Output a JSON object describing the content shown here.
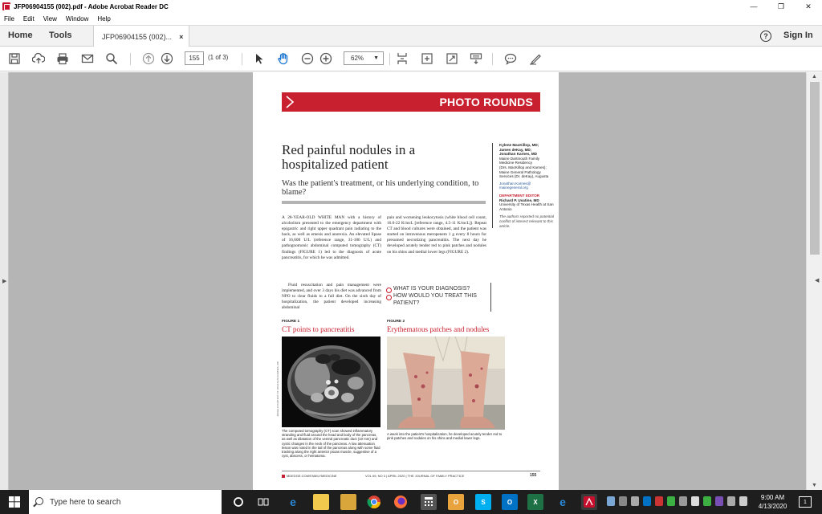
{
  "window": {
    "title": "JFP06904155 (002).pdf - Adobe Acrobat Reader DC",
    "minimize": "—",
    "restore": "❐",
    "close": "✕"
  },
  "menu": [
    "File",
    "Edit",
    "View",
    "Window",
    "Help"
  ],
  "tabs": {
    "home": "Home",
    "tools": "Tools",
    "doc": "JFP06904155 (002)...",
    "close": "×",
    "help": "?",
    "signin": "Sign In"
  },
  "toolbar": {
    "page_current": "155",
    "page_of": "(1 of 3)",
    "zoom": "62%"
  },
  "doc": {
    "banner": "PHOTO ROUNDS",
    "title": "Red painful nodules in a hospitalized patient",
    "subtitle": "Was the patient's treatment, or his underlying condition, to blame?",
    "authors": [
      {
        "text": "Kylene MacKillop, MD;",
        "bold": true
      },
      {
        "text": "James deKay, MD;",
        "bold": true
      },
      {
        "text": "Jonathan Karnes, MD",
        "bold": true
      },
      {
        "text": "Maine Dartmouth Family Medicine Residency",
        "bold": false
      },
      {
        "text": "(Drs. MacKillop and Karnes); Maine General Pathology Services (Dr. deKay), Augusta",
        "bold": false
      }
    ],
    "email": "Jonathan.Karnes@ mainegeneral.org",
    "dept_label": "DEPARTMENT EDITOR",
    "dept_name": "Richard P. Usatine, MD",
    "dept_affil": "University of Texas Health at San Antonio",
    "disclosure": "The authors reported no potential conflict of interest relevant to this article.",
    "col1_p1": "A 28-YEAR-OLD WHITE MAN with a history of alcoholism presented to the emergency department with epigastric and right upper quadrant pain radiating to the back, as well as emesis and anorexia. An elevated lipase of 16,608 U/L (reference range, 31-186 U/L) and pathognomonic abdominal computed tomography (CT) findings (FIGURE 1) led to the diagnosis of acute pancreatitis, for which he was admitted.",
    "col1_p2": "Fluid resuscitation and pain management were implemented, and over 3 days his diet was advanced from NPO to clear fluids to a full diet. On the sixth day of hospitalization, the patient developed increasing abdominal",
    "col2_p1": "pain and worsening leukocytosis (white blood cell count, 16.6-22 K/mcL [reference range, 4.5-11 K/mcL]). Repeat CT and blood cultures were obtained, and the patient was started on intravenous meropenem 1 g every 8 hours for presumed necrotizing pancreatitis. The next day he developed acutely tender red to pink patches and nodules on his shins and medial lower legs (FIGURE 2).",
    "questions": [
      "WHAT IS YOUR DIAGNOSIS?",
      "HOW WOULD YOU TREAT THIS PATIENT?"
    ],
    "fig1_label": "FIGURE 1",
    "fig1_title": "CT points to pancreatitis",
    "fig1_caption": "The computed tomography (CT) scan showed inflammatory stranding and fluid around the head and body of the pancreas, as well as dilatation of the ventral pancreatic duct (10 mm) and cystic changes in the neck of the pancreas. A low attenuation lesion was noted in the tail of the pancreas along with some fluid tracking along the right anterior psoas muscle, suggestive of a cyst, abscess, or hematoma.",
    "fig2_label": "FIGURE 2",
    "fig2_title": "Erythematous patches and nodules",
    "fig2_caption": "A week into the patient's hospitalization, he developed acutely tender red to pink patches and nodules on his shins and medial lower legs.",
    "footer_left": "MDEDGE.COM/FAMILYMEDICINE",
    "footer_mid": "VOL 69, NO 3  |  APRIL 2020  |  THE JOURNAL OF FAMILY PRACTICE",
    "footer_page": "155",
    "credit": "IMAGE COURTESY OF JONATHAN KARNES, MD"
  },
  "taskbar": {
    "search_placeholder": "Type here to search",
    "time": "9:00 AM",
    "date": "4/13/2020",
    "notif": "1"
  },
  "colors": {
    "accent": "#c8202f",
    "taskbar": "#1e1e1e"
  }
}
